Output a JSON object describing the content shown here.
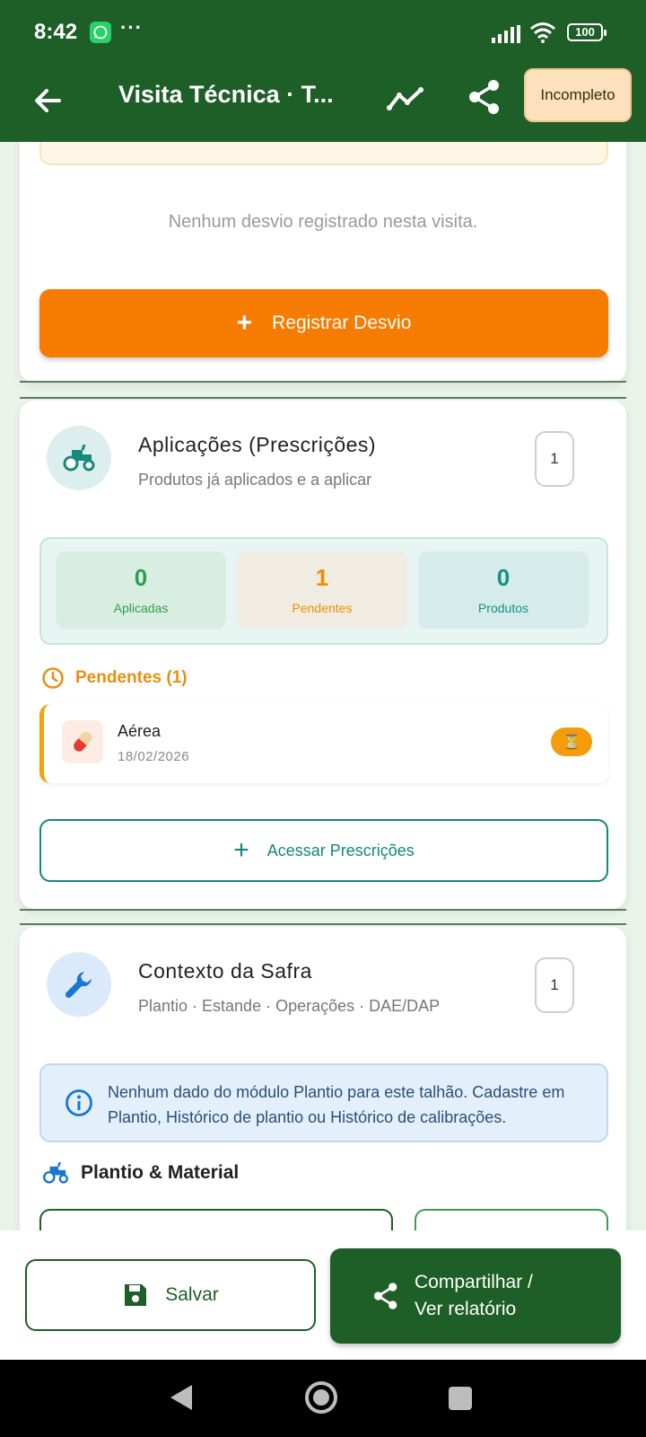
{
  "status_bar": {
    "time": "8:42",
    "more": "···",
    "battery": "100"
  },
  "app_bar": {
    "title": "Visita Técnica · T...",
    "badge": "Incompleto"
  },
  "desvios": {
    "empty_text": "Nenhum desvio registrado nesta visita.",
    "register_button": "Registrar Desvio",
    "plus": "+"
  },
  "aplicacoes": {
    "title": "Aplicações (Prescrições)",
    "subtitle": "Produtos já aplicados e a aplicar",
    "count": "1",
    "stats": [
      {
        "value": "0",
        "label": "Aplicadas"
      },
      {
        "value": "1",
        "label": "Pendentes"
      },
      {
        "value": "0",
        "label": "Produtos"
      }
    ],
    "pending_heading": "Pendentes (1)",
    "pending_items": [
      {
        "name": "Aérea",
        "date": "18/02/2026",
        "status_icon": "⏳"
      }
    ],
    "access_button": "Acessar Prescrições",
    "plus": "+"
  },
  "contexto": {
    "title": "Contexto da Safra",
    "subtitle": "Plantio · Estande · Operações · DAE/DAP",
    "count": "1",
    "info_text": "Nenhum dado do módulo Plantio para este talhão. Cadastre em Plantio, Histórico de plantio ou Histórico de calibrações.",
    "section_heading": "Plantio & Material"
  },
  "bottom_bar": {
    "save_label": "Salvar",
    "share_line1": "Compartilhar /",
    "share_line2": "Ver relatório"
  },
  "colors": {
    "primary": "#1e5e27",
    "accent_orange": "#f57c00",
    "teal": "#12877a",
    "info_blue": "#2a4f78"
  },
  "icons": {
    "back": "arrow-left-icon",
    "trend": "trend-line-icon",
    "share": "share-icon",
    "tractor": "tractor-icon",
    "wrench": "wrench-icon",
    "clock": "clock-icon",
    "pill": "pill-icon",
    "info": "info-icon",
    "save": "floppy-disk-icon"
  }
}
